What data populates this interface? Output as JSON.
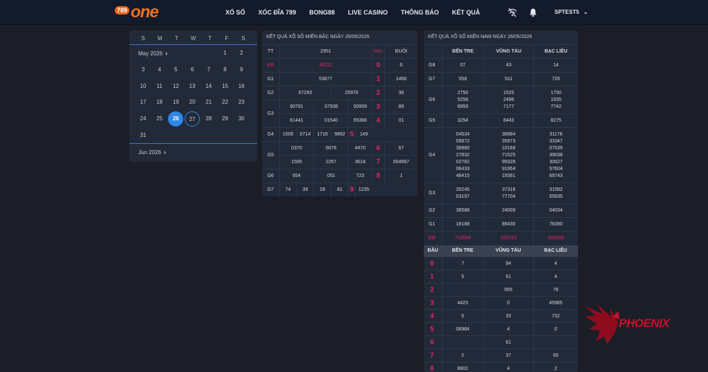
{
  "brand": {
    "logo_number": "789",
    "logo_word": "one"
  },
  "nav": [
    "XỔ SỐ",
    "XÓC ĐĨA 789",
    "BONG88",
    "LIVE CASINO",
    "THÔNG BÁO",
    "KẾT QUẢ"
  ],
  "user": {
    "name": "SPTEST5"
  },
  "icons": [
    "no-signal-icon",
    "bell-icon",
    "chevron-down-icon"
  ],
  "calendar": {
    "weekdays": [
      "S",
      "M",
      "T",
      "W",
      "T",
      "F",
      "S"
    ],
    "month_label": "May 2026",
    "next_month_label": "Jun 2026",
    "days": [
      "1",
      "2",
      "3",
      "4",
      "5",
      "6",
      "7",
      "8",
      "9",
      "10",
      "11",
      "12",
      "13",
      "14",
      "15",
      "16",
      "17",
      "18",
      "19",
      "20",
      "21",
      "22",
      "23",
      "24",
      "25",
      "26",
      "27",
      "28",
      "29",
      "30",
      "31"
    ],
    "selected": "26",
    "today": "27"
  },
  "north": {
    "title": "KẾT QUẢ XỔ SỐ MIỀN BẮC NGÀY 26/05/2026",
    "headers": {
      "tt": "TT",
      "code": "2951",
      "dau": "ĐẦU",
      "duoi": "ĐUÔI"
    },
    "rows": [
      {
        "label": "ĐB",
        "values": [
          "49111"
        ]
      },
      {
        "label": "G1",
        "values": [
          "53877"
        ]
      },
      {
        "label": "G2",
        "values": [
          "67293",
          "25976"
        ]
      },
      {
        "label": "G3",
        "values": [
          "90791",
          "37938",
          "50959",
          "61441",
          "01540",
          "65366"
        ]
      },
      {
        "label": "G4",
        "values": [
          "1506",
          "0714",
          "1716",
          "9892"
        ]
      },
      {
        "label": "G5",
        "values": [
          "0370",
          "6676",
          "4470",
          "1595",
          "2267",
          "3618"
        ]
      },
      {
        "label": "G6",
        "values": [
          "654",
          "051",
          "723"
        ]
      },
      {
        "label": "G7",
        "values": [
          "74",
          "39",
          "28",
          "81"
        ]
      }
    ],
    "dau": [
      "0",
      "1",
      "2",
      "3",
      "4",
      "5",
      "6",
      "7",
      "8",
      "9"
    ],
    "duoi": [
      "6",
      "1468",
      "38",
      "89",
      "01",
      "149",
      "67",
      "004667",
      "1",
      "1235"
    ]
  },
  "south": {
    "title": "KẾT QUẢ XỔ SỐ MIỀN NAM NGÀY 26/05/2026",
    "provinces": [
      "BẾN TRE",
      "VŨNG TÀU",
      "BẠC LIÊU"
    ],
    "rows": [
      {
        "label": "G8",
        "cols": [
          [
            "07"
          ],
          [
            "43"
          ],
          [
            "14"
          ]
        ]
      },
      {
        "label": "G7",
        "cols": [
          [
            "058"
          ],
          [
            "511"
          ],
          [
            "726"
          ]
        ]
      },
      {
        "label": "G6",
        "cols": [
          [
            "2750",
            "5258",
            "8959"
          ],
          [
            "1525",
            "2496",
            "7177"
          ],
          [
            "1750",
            "1935",
            "7742"
          ]
        ]
      },
      {
        "label": "G5",
        "cols": [
          [
            "3254"
          ],
          [
            "8443"
          ],
          [
            "8275"
          ]
        ]
      },
      {
        "label": "G4",
        "cols": [
          [
            "04534",
            "05872",
            "38980",
            "27832",
            "02782",
            "06433",
            "46415"
          ],
          [
            "38984",
            "35973",
            "10166",
            "71525",
            "99326",
            "91954",
            "19361"
          ],
          [
            "31176",
            "33347",
            "07539",
            "39038",
            "30627",
            "57604",
            "69743"
          ]
        ]
      },
      {
        "label": "G3",
        "cols": [
          [
            "35245",
            "03197"
          ],
          [
            "37316",
            "77704"
          ],
          [
            "31582",
            "55935"
          ]
        ]
      },
      {
        "label": "G2",
        "cols": [
          [
            "38588"
          ],
          [
            "24009"
          ],
          [
            "04034"
          ]
        ]
      },
      {
        "label": "G1",
        "cols": [
          [
            "18188"
          ],
          [
            "89430"
          ],
          [
            "78390"
          ]
        ]
      },
      {
        "label": "ĐB",
        "cols": [
          [
            "713084"
          ],
          [
            "333316"
          ],
          [
            "085836"
          ]
        ]
      }
    ],
    "dau_header": "ĐẦU",
    "dau_rows": [
      {
        "d": "0",
        "cols": [
          "7",
          "94",
          "4"
        ]
      },
      {
        "d": "1",
        "cols": [
          "5",
          "61",
          "4"
        ]
      },
      {
        "d": "2",
        "cols": [
          "",
          "565",
          "76"
        ]
      },
      {
        "d": "3",
        "cols": [
          "4423",
          "0",
          "45985"
        ]
      },
      {
        "d": "4",
        "cols": [
          "5",
          "33",
          "732"
        ]
      },
      {
        "d": "5",
        "cols": [
          "08984",
          "4",
          "0"
        ]
      },
      {
        "d": "6",
        "cols": [
          "",
          "61",
          ""
        ]
      },
      {
        "d": "7",
        "cols": [
          "2",
          "37",
          "65"
        ]
      },
      {
        "d": "8",
        "cols": [
          "8802",
          "4",
          "2"
        ]
      }
    ]
  },
  "watermark": {
    "text": "PHOENIX"
  },
  "colors": {
    "accent": "#2f87e8",
    "highlight": "#e3245f",
    "brand": "#ee6f21",
    "header_bg": "#121a2b",
    "panel_bg": "#222a39",
    "page_bg": "#1b1e26"
  }
}
